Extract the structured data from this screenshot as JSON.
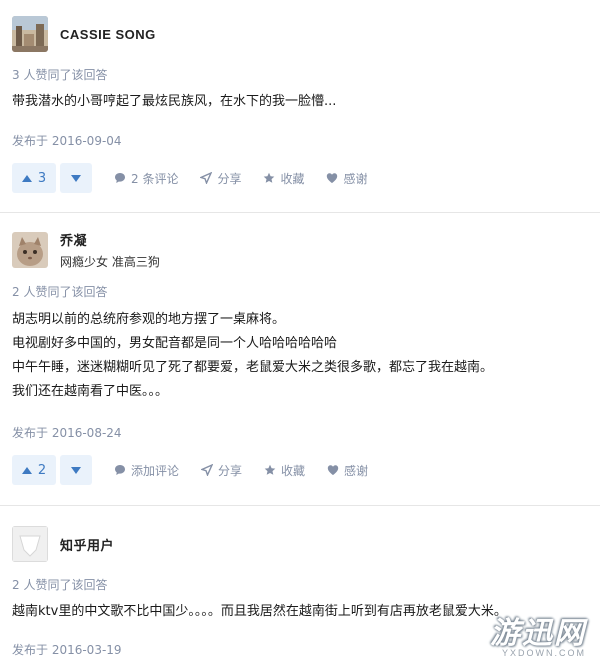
{
  "answers": [
    {
      "author": "CASSIE SONG",
      "bio": "",
      "votes_text": "3 人赞同了该回答",
      "content": [
        "带我潜水的小哥哼起了最炫民族风，在水下的我一脸懵..."
      ],
      "date": "发布于 2016-09-04",
      "upvotes": "3",
      "comments": "2 条评论",
      "share": "分享",
      "collect": "收藏",
      "thanks": "感谢"
    },
    {
      "author": "乔凝",
      "bio": "网瘾少女 准高三狗",
      "votes_text": "2 人赞同了该回答",
      "content": [
        "胡志明以前的总统府参观的地方摆了一桌麻将。",
        "电视剧好多中国的，男女配音都是同一个人哈哈哈哈哈哈",
        "中午午睡，迷迷糊糊听见了死了都要爱，老鼠爱大米之类很多歌，都忘了我在越南。",
        "我们还在越南看了中医。。。"
      ],
      "date": "发布于 2016-08-24",
      "upvotes": "2",
      "comments": "添加评论",
      "share": "分享",
      "collect": "收藏",
      "thanks": "感谢"
    },
    {
      "author": "知乎用户",
      "bio": "",
      "votes_text": "2 人赞同了该回答",
      "content": [
        "越南ktv里的中文歌不比中国少。。。。而且我居然在越南街上听到有店再放老鼠爱大米。"
      ],
      "date": "发布于 2016-03-19"
    }
  ],
  "watermark": {
    "big": "游迅网",
    "small": "YXDOWN.COM"
  },
  "colors": {
    "accent": "#3e7ac2",
    "vote_bg": "#eaf2fb",
    "muted": "#8590a6"
  }
}
